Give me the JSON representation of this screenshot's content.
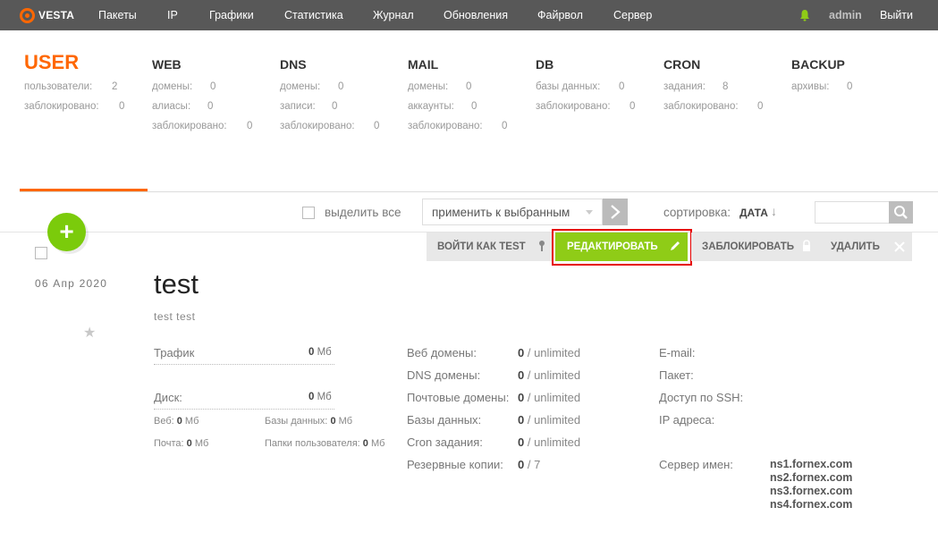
{
  "app": {
    "logo_text": "VESTA",
    "accent_color": "#ff6701",
    "topbar_color": "#585858"
  },
  "nav": {
    "items": [
      "Пакеты",
      "IP",
      "Графики",
      "Статистика",
      "Журнал",
      "Обновления",
      "Файрвол",
      "Сервер"
    ],
    "user": "admin",
    "logout": "Выйти",
    "bell_icon": "bell-icon"
  },
  "stats": {
    "user": {
      "title": "USER",
      "rows": [
        [
          "пользователи:",
          "2"
        ],
        [
          "заблокировано:",
          "0"
        ]
      ]
    },
    "web": {
      "title": "WEB",
      "rows": [
        [
          "домены:",
          "0"
        ],
        [
          "алиасы:",
          "0"
        ],
        [
          "заблокировано:",
          "0"
        ]
      ]
    },
    "dns": {
      "title": "DNS",
      "rows": [
        [
          "домены:",
          "0"
        ],
        [
          "записи:",
          "0"
        ],
        [
          "заблокировано:",
          "0"
        ]
      ]
    },
    "mail": {
      "title": "MAIL",
      "rows": [
        [
          "домены:",
          "0"
        ],
        [
          "аккаунты:",
          "0"
        ],
        [
          "заблокировано:",
          "0"
        ]
      ]
    },
    "db": {
      "title": "DB",
      "rows": [
        [
          "базы данных:",
          "0"
        ],
        [
          "заблокировано:",
          "0"
        ]
      ]
    },
    "cron": {
      "title": "CRON",
      "rows": [
        [
          "задания:",
          "8"
        ],
        [
          "заблокировано:",
          "0"
        ]
      ]
    },
    "backup": {
      "title": "BACKUP",
      "rows": [
        [
          "архивы:",
          "0"
        ]
      ]
    }
  },
  "toolbar": {
    "select_all": "выделить все",
    "bulk_action": "применить к выбранным",
    "sort_label": "сортировка:",
    "sort_value": "ДАТА",
    "sort_arrow": "↓",
    "search_value": "",
    "add_icon": "+"
  },
  "actions": {
    "login_as": "ВОЙТИ КАК TEST",
    "edit": "РЕДАКТИРОВАТЬ",
    "suspend": "ЗАБЛОКИРОВАТЬ",
    "delete": "УДАЛИТЬ"
  },
  "user_row": {
    "date": "06  Апр  2020",
    "username": "test",
    "fullname": "test test",
    "star": "★",
    "traffic_label": "Трафик",
    "traffic_value": "0",
    "traffic_unit": " Мб",
    "disk_label": "Диск:",
    "disk_value": "0",
    "disk_unit": " Мб",
    "disk_web_label": "Веб: ",
    "disk_web_value": "0",
    "disk_web_unit": " Мб",
    "disk_db_label": "Базы данных: ",
    "disk_db_value": "0",
    "disk_db_unit": " Мб",
    "disk_mail_label": "Почта: ",
    "disk_mail_value": "0",
    "disk_mail_unit": " Мб",
    "disk_dirs_label": "Папки пользователя: ",
    "disk_dirs_value": "0",
    "disk_dirs_unit": " Мб",
    "limits": [
      {
        "label": "Веб домены:",
        "used": "0",
        "limit": " / unlimited"
      },
      {
        "label": "DNS домены:",
        "used": "0",
        "limit": " / unlimited"
      },
      {
        "label": "Почтовые домены:",
        "used": "0",
        "limit": " / unlimited"
      },
      {
        "label": "Базы данных:",
        "used": "0",
        "limit": " / unlimited"
      },
      {
        "label": "Cron задания:",
        "used": "0",
        "limit": " / unlimited"
      },
      {
        "label": "Резервные копии:",
        "used": "0",
        "limit": " / 7"
      }
    ],
    "info": {
      "email_label": "E-mail:",
      "package_label": "Пакет:",
      "ssh_label": "Доступ по SSH:",
      "ip_label": "IP адреса:",
      "ns_label": "Сервер имен:",
      "ns": [
        "ns1.fornex.com",
        "ns2.fornex.com",
        "ns3.fornex.com",
        "ns4.fornex.com"
      ]
    }
  }
}
